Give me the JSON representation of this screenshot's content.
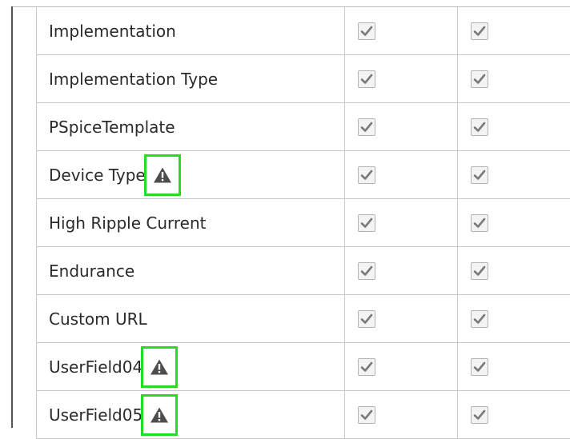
{
  "colors": {
    "highlight": "#22dd22",
    "check": "#7a7a7a",
    "grid": "#c8c8c8",
    "text": "#2a2a2a"
  },
  "rows": [
    {
      "label": "Implementation",
      "warning": false,
      "checked": [
        true,
        true
      ]
    },
    {
      "label": "Implementation Type",
      "warning": false,
      "checked": [
        true,
        true
      ]
    },
    {
      "label": "PSpiceTemplate",
      "warning": false,
      "checked": [
        true,
        true
      ]
    },
    {
      "label": "Device Type",
      "warning": true,
      "checked": [
        true,
        true
      ]
    },
    {
      "label": "High Ripple Current",
      "warning": false,
      "checked": [
        true,
        true
      ]
    },
    {
      "label": "Endurance",
      "warning": false,
      "checked": [
        true,
        true
      ]
    },
    {
      "label": "Custom URL",
      "warning": false,
      "checked": [
        true,
        true
      ]
    },
    {
      "label": "UserField04",
      "warning": true,
      "checked": [
        true,
        true
      ]
    },
    {
      "label": "UserField05",
      "warning": true,
      "checked": [
        true,
        true
      ]
    }
  ],
  "icons": {
    "warning": "warning-triangle-icon",
    "check": "checkmark-icon"
  }
}
